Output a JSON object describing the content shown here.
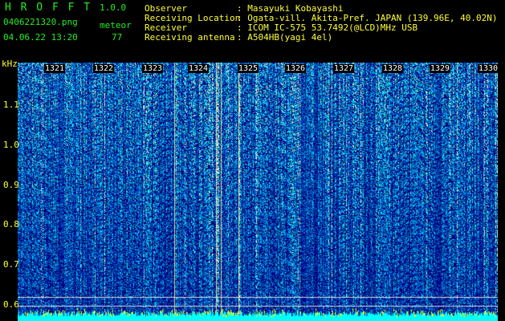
{
  "header": {
    "app_name": "H R O F F T",
    "version": "1.0.0",
    "filename": "0406221320.png",
    "mode": "meteor",
    "datetime": "04.06.22 13:20",
    "count": "77",
    "info": [
      {
        "label": "Observer",
        "value": ": Masayuki Kobayashi"
      },
      {
        "label": "Receiving Location",
        "value": ": Ogata-vill. Akita-Pref. JAPAN (139.96E, 40.02N)"
      },
      {
        "label": "Receiver",
        "value": ": ICOM IC-575 53.7492(@LCD)MHz USB"
      },
      {
        "label": "Receiving antenna",
        "value": ": A504HB(yagi 4el)"
      }
    ]
  },
  "spectrogram": {
    "y_unit": "kHz",
    "y_ticks": [
      "1.1",
      "1.0",
      "0.9",
      "0.8",
      "0.7",
      "0.6"
    ],
    "time_marks": [
      "1321",
      "1322",
      "1323",
      "1324",
      "1325",
      "1326",
      "1327",
      "1328",
      "1329",
      "1330"
    ]
  }
}
